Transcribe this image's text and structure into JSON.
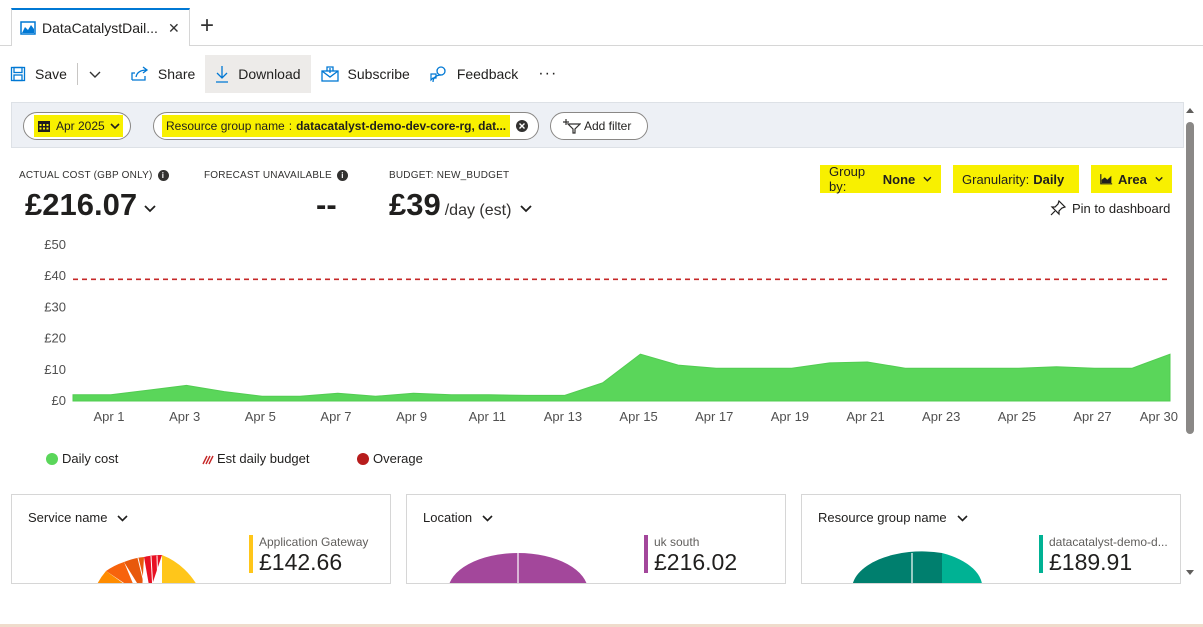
{
  "tab": {
    "title": "DataCatalystDail...",
    "close": "✕",
    "new": "+"
  },
  "toolbar": {
    "save": "Save",
    "share": "Share",
    "download": "Download",
    "subscribe": "Subscribe",
    "feedback": "Feedback",
    "more": "···"
  },
  "filters": {
    "date": "Apr 2025",
    "rg_label": "Resource group name",
    "rg_sep": ":",
    "rg_value": "datacatalyst-demo-dev-core-rg, dat...",
    "add": "Add filter"
  },
  "metrics": {
    "actual_label": "ACTUAL COST (GBP ONLY)",
    "actual_value": "£216.07",
    "forecast_label": "FORECAST UNAVAILABLE",
    "forecast_value": "--",
    "budget_label": "BUDGET: NEW_BUDGET",
    "budget_value": "£39",
    "budget_sub": "/day (est)"
  },
  "controls": {
    "groupby_label": "Group by:",
    "groupby_value": "None",
    "granularity_label": "Granularity:",
    "granularity_value": "Daily",
    "charttype": "Area",
    "pin": "Pin to dashboard"
  },
  "colors": {
    "area": "#5ad65a",
    "budget": "#c62828",
    "overage": "#b71c1c",
    "accent": "#0078d4",
    "highlight": "#f8f000"
  },
  "chart_data": {
    "type": "area",
    "x": [
      "Apr 1",
      "Apr 2",
      "Apr 3",
      "Apr 4",
      "Apr 5",
      "Apr 6",
      "Apr 7",
      "Apr 8",
      "Apr 9",
      "Apr 10",
      "Apr 11",
      "Apr 12",
      "Apr 13",
      "Apr 14",
      "Apr 15",
      "Apr 16",
      "Apr 17",
      "Apr 18",
      "Apr 19",
      "Apr 20",
      "Apr 21",
      "Apr 22",
      "Apr 23",
      "Apr 24",
      "Apr 25",
      "Apr 26",
      "Apr 27",
      "Apr 28",
      "Apr 29",
      "Apr 30"
    ],
    "tick_labels": [
      "Apr 1",
      "Apr 3",
      "Apr 5",
      "Apr 7",
      "Apr 9",
      "Apr 11",
      "Apr 13",
      "Apr 15",
      "Apr 17",
      "Apr 19",
      "Apr 21",
      "Apr 23",
      "Apr 25",
      "Apr 27",
      "Apr 30"
    ],
    "series": [
      {
        "name": "Daily cost",
        "values": [
          2.0,
          2.0,
          3.5,
          5.0,
          3.0,
          1.5,
          1.5,
          2.5,
          1.5,
          2.5,
          2.0,
          2.0,
          1.8,
          1.8,
          5.8,
          15.0,
          11.5,
          10.5,
          10.5,
          10.5,
          12.2,
          12.5,
          10.5,
          10.5,
          10.5,
          10.5,
          11.0,
          10.5,
          10.5,
          15.0
        ]
      }
    ],
    "budget": {
      "name": "Est daily budget",
      "value": 39
    },
    "overage": {
      "name": "Overage"
    },
    "yticks": [
      "£0",
      "£10",
      "£20",
      "£30",
      "£40",
      "£50"
    ],
    "ylim": [
      0,
      50
    ]
  },
  "legend": {
    "daily": "Daily cost",
    "budget": "Est daily budget",
    "overage": "Overage"
  },
  "cards": [
    {
      "title": "Service name",
      "entry_label": "Application Gateway",
      "entry_value": "£142.66",
      "color": "#ffc61a"
    },
    {
      "title": "Location",
      "entry_label": "uk south",
      "entry_value": "£216.02",
      "color": "#a3479b"
    },
    {
      "title": "Resource group name",
      "entry_label": "datacatalyst-demo-d...",
      "entry_value": "£189.91",
      "color": "#00b294"
    }
  ]
}
